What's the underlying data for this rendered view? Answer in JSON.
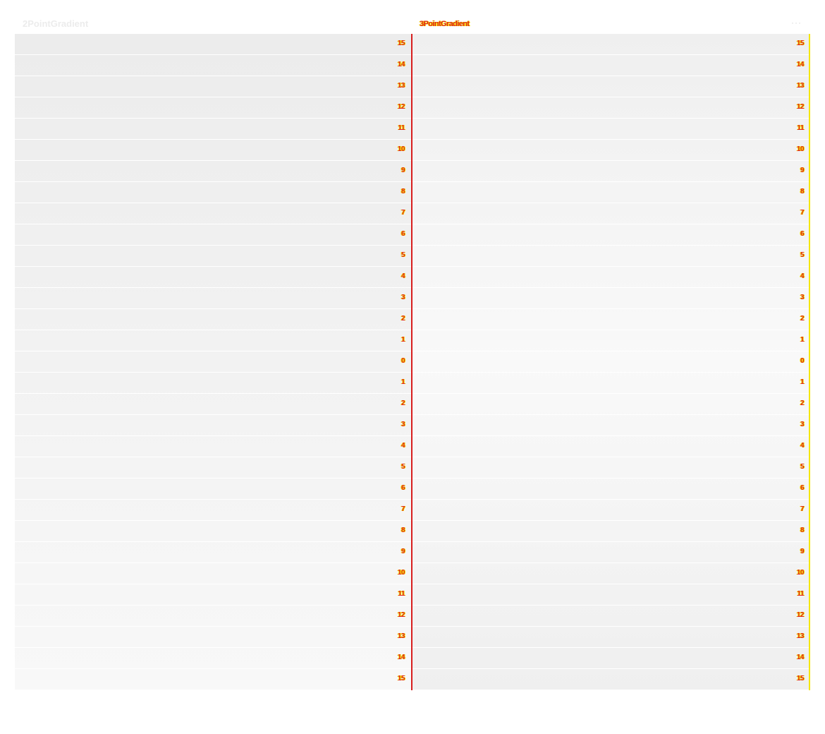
{
  "panels": {
    "left_title": "2PointGradient",
    "right_title": "3PointGradient"
  },
  "menu": {
    "icon": "more-icon",
    "glyph": "···"
  },
  "colors": {
    "gradient_start": "#ececec",
    "gradient_end": "#f8f8f8",
    "label_primary": "#e02020",
    "label_outline": "#f4e600",
    "divider_red": "#d81e1e",
    "divider_yellow": "#f4e600"
  },
  "rows": [
    "15",
    "14",
    "13",
    "12",
    "11",
    "10",
    "9",
    "8",
    "7",
    "6",
    "5",
    "4",
    "3",
    "2",
    "1",
    "0",
    "1",
    "2",
    "3",
    "4",
    "5",
    "6",
    "7",
    "8",
    "9",
    "10",
    "11",
    "12",
    "13",
    "14",
    "15"
  ]
}
